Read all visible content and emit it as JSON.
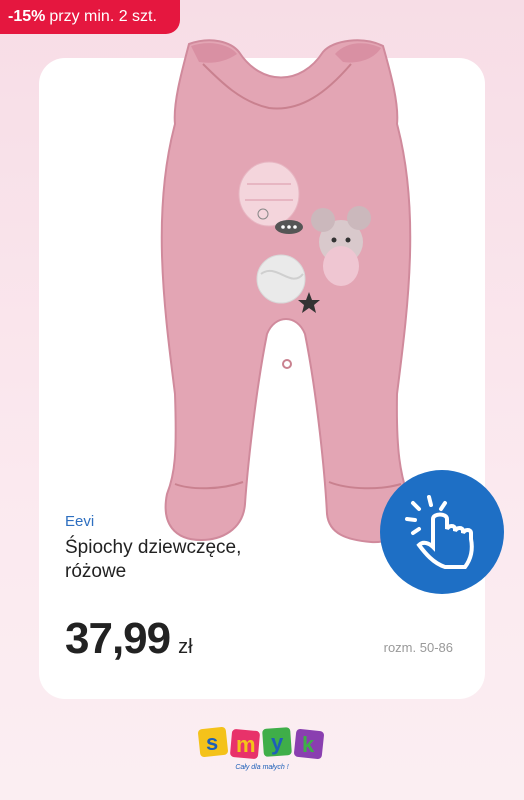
{
  "promo": {
    "discount": "-15%",
    "condition": "przy min. 2 szt."
  },
  "product": {
    "brand": "Eevi",
    "name": "Śpiochy dziewczęce, różowe",
    "price": "37,99",
    "currency": "zł",
    "size_label": "rozm. 50-86",
    "image_icon": "baby-romper-pink"
  },
  "tap_icon": "tap-hand-icon",
  "logo": {
    "letters": [
      "s",
      "m",
      "y",
      "k"
    ],
    "tagline": "Cały dla małych !"
  },
  "colors": {
    "promo_bg": "#e5173f",
    "brand_text": "#2e6fc0",
    "badge_bg": "#1e6fc5",
    "background": "#f7dde6",
    "romper": "#e3a5b4"
  }
}
